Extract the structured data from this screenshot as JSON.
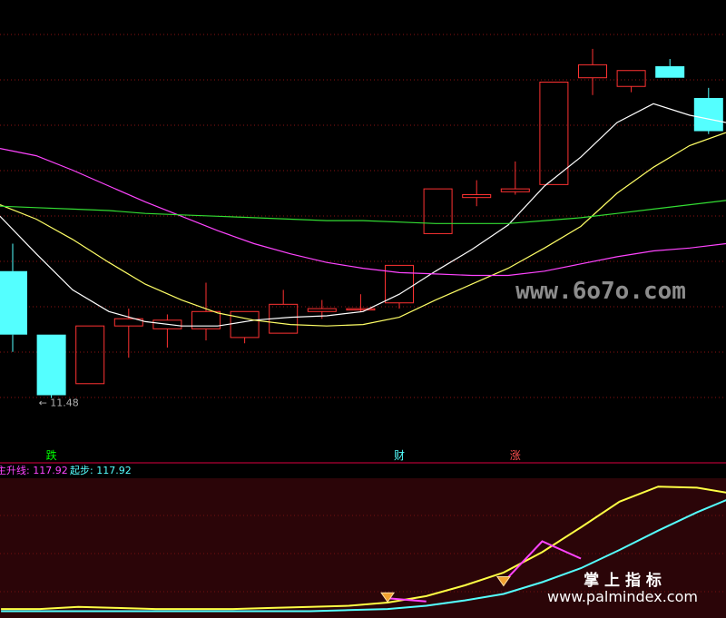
{
  "chart_data": [
    {
      "type": "candlestick",
      "panel": "price",
      "candles": [
        {
          "open": 12.36,
          "high": 12.55,
          "low": 11.8,
          "close": 11.92
        },
        {
          "open": 11.92,
          "high": 11.92,
          "low": 11.48,
          "close": 11.5
        },
        {
          "open": 11.58,
          "high": 11.98,
          "low": 11.58,
          "close": 11.98
        },
        {
          "open": 11.98,
          "high": 12.1,
          "low": 11.76,
          "close": 12.03
        },
        {
          "open": 11.96,
          "high": 12.06,
          "low": 11.83,
          "close": 12.02
        },
        {
          "open": 11.96,
          "high": 12.28,
          "low": 11.88,
          "close": 12.08
        },
        {
          "open": 11.9,
          "high": 12.08,
          "low": 11.86,
          "close": 12.08
        },
        {
          "open": 11.93,
          "high": 12.23,
          "low": 11.93,
          "close": 12.13
        },
        {
          "open": 12.08,
          "high": 12.16,
          "low": 12.03,
          "close": 12.1
        },
        {
          "open": 12.1,
          "high": 12.2,
          "low": 12.08,
          "close": 12.1
        },
        {
          "open": 12.14,
          "high": 12.4,
          "low": 12.1,
          "close": 12.4
        },
        {
          "open": 12.62,
          "high": 12.93,
          "low": 12.62,
          "close": 12.93
        },
        {
          "open": 12.87,
          "high": 12.99,
          "low": 12.81,
          "close": 12.89
        },
        {
          "open": 12.91,
          "high": 13.12,
          "low": 12.89,
          "close": 12.93
        },
        {
          "open": 12.96,
          "high": 13.67,
          "low": 12.96,
          "close": 13.67
        },
        {
          "open": 13.7,
          "high": 13.9,
          "low": 13.58,
          "close": 13.79
        },
        {
          "open": 13.64,
          "high": 13.75,
          "low": 13.6,
          "close": 13.75
        },
        {
          "open": 13.78,
          "high": 13.83,
          "low": 13.7,
          "close": 13.7
        },
        {
          "open": 13.56,
          "high": 13.63,
          "low": 13.31,
          "close": 13.33
        },
        {
          "open": 13.36,
          "high": 13.38,
          "low": 13.28,
          "close": 13.28
        }
      ],
      "up_color": "#ff3232",
      "down_color": "#54ffff",
      "moving_averages": [
        {
          "color": "#ffffff",
          "values": [
            12.74,
            12.48,
            12.23,
            12.08,
            12.01,
            11.98,
            11.98,
            12.02,
            12.04,
            12.05,
            12.08,
            12.2,
            12.36,
            12.51,
            12.68,
            12.95,
            13.15,
            13.39,
            13.52,
            13.44,
            13.39
          ]
        },
        {
          "color": "#ffff66",
          "values": [
            12.82,
            12.72,
            12.58,
            12.42,
            12.27,
            12.16,
            12.07,
            12.02,
            11.99,
            11.98,
            11.99,
            12.04,
            12.16,
            12.27,
            12.38,
            12.52,
            12.67,
            12.9,
            13.08,
            13.23,
            13.32
          ]
        },
        {
          "color": "#ff44ff",
          "values": [
            13.21,
            13.16,
            13.06,
            12.95,
            12.84,
            12.74,
            12.64,
            12.55,
            12.48,
            12.42,
            12.38,
            12.35,
            12.34,
            12.33,
            12.33,
            12.36,
            12.41,
            12.46,
            12.5,
            12.52,
            12.55
          ]
        },
        {
          "color": "#33dd33",
          "values": [
            12.81,
            12.8,
            12.79,
            12.78,
            12.76,
            12.75,
            12.74,
            12.73,
            12.72,
            12.71,
            12.71,
            12.7,
            12.69,
            12.69,
            12.69,
            12.71,
            12.73,
            12.76,
            12.79,
            12.82,
            12.85
          ]
        }
      ],
      "annotations": [
        {
          "text": "← 11.48",
          "candle": 1,
          "color": "#b0b0b0"
        },
        {
          "text": "跌",
          "candle": 1,
          "color": "#00ff00"
        },
        {
          "text": "财",
          "candle": 10,
          "color": "#54ffff"
        },
        {
          "text": "涨",
          "candle": 13,
          "color": "#ff5050"
        }
      ]
    },
    {
      "type": "line",
      "panel": "indicator",
      "legend": [
        {
          "text": "主升线: 117.92",
          "color": "#ff44ff"
        },
        {
          "text": "起步: 117.92",
          "color": "#54ffff"
        }
      ],
      "ylim": [
        0,
        120
      ],
      "series": [
        {
          "color": "#ffff44",
          "values": [
            5,
            5,
            7,
            6,
            5,
            5,
            5,
            6,
            7,
            8,
            11,
            17,
            27,
            39,
            58,
            81,
            105,
            119,
            118,
            112,
            101,
            93,
            86
          ]
        },
        {
          "color": "#54ffff",
          "values": [
            3,
            3,
            3,
            3,
            3,
            3,
            3,
            3,
            3,
            4,
            5,
            8,
            13,
            19,
            30,
            43,
            60,
            78,
            95,
            110,
            119,
            123,
            124
          ]
        },
        {
          "color": "#ff44ff",
          "values": [
            null,
            null,
            null,
            null,
            null,
            null,
            null,
            null,
            null,
            null,
            15,
            12,
            null,
            30,
            68,
            52,
            null,
            null,
            null,
            null,
            null,
            null,
            null
          ]
        }
      ],
      "markers": [
        10,
        13
      ]
    }
  ],
  "watermarks": [
    "www.6o7o.com",
    "掌 上 指 标",
    "www.palmindex.com"
  ]
}
